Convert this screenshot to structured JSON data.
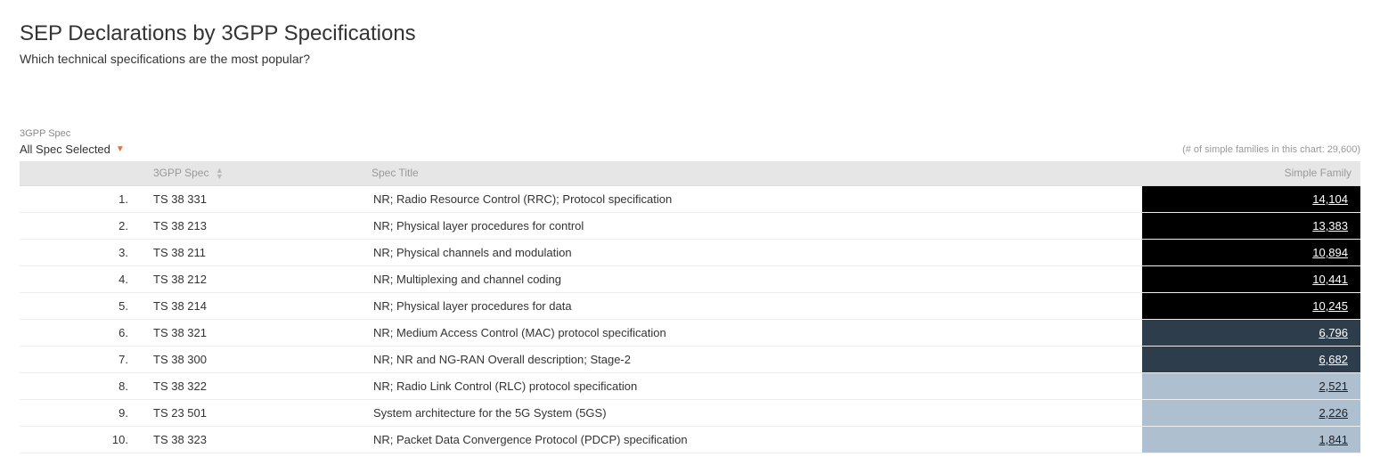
{
  "title": "SEP Declarations by 3GPP Specifications",
  "subtitle": "Which technical specifications are the most popular?",
  "filter": {
    "label": "3GPP Spec",
    "selected": "All Spec Selected"
  },
  "count_note": "(# of simple families in this chart: 29,600)",
  "columns": {
    "rank": "",
    "spec": "3GPP Spec",
    "title": "Spec Title",
    "family": "Simple Family"
  },
  "heat_max": 14104,
  "rows": [
    {
      "rank": "1.",
      "spec": "TS 38 331",
      "title": "NR; Radio Resource Control (RRC); Protocol specification",
      "family": "14,104",
      "val": 14104
    },
    {
      "rank": "2.",
      "spec": "TS 38 213",
      "title": "NR; Physical layer procedures for control",
      "family": "13,383",
      "val": 13383
    },
    {
      "rank": "3.",
      "spec": "TS 38 211",
      "title": "NR; Physical channels and modulation",
      "family": "10,894",
      "val": 10894
    },
    {
      "rank": "4.",
      "spec": "TS 38 212",
      "title": "NR; Multiplexing and channel coding",
      "family": "10,441",
      "val": 10441
    },
    {
      "rank": "5.",
      "spec": "TS 38 214",
      "title": "NR; Physical layer procedures for data",
      "family": "10,245",
      "val": 10245
    },
    {
      "rank": "6.",
      "spec": "TS 38 321",
      "title": "NR; Medium Access Control (MAC) protocol specification",
      "family": "6,796",
      "val": 6796
    },
    {
      "rank": "7.",
      "spec": "TS 38 300",
      "title": "NR; NR and NG-RAN Overall description; Stage-2",
      "family": "6,682",
      "val": 6682
    },
    {
      "rank": "8.",
      "spec": "TS 38 322",
      "title": "NR; Radio Link Control (RLC) protocol specification",
      "family": "2,521",
      "val": 2521
    },
    {
      "rank": "9.",
      "spec": "TS 23 501",
      "title": "System architecture for the 5G System (5GS)",
      "family": "2,226",
      "val": 2226
    },
    {
      "rank": "10.",
      "spec": "TS 38 323",
      "title": "NR; Packet Data Convergence Protocol (PDCP) specification",
      "family": "1,841",
      "val": 1841
    }
  ]
}
